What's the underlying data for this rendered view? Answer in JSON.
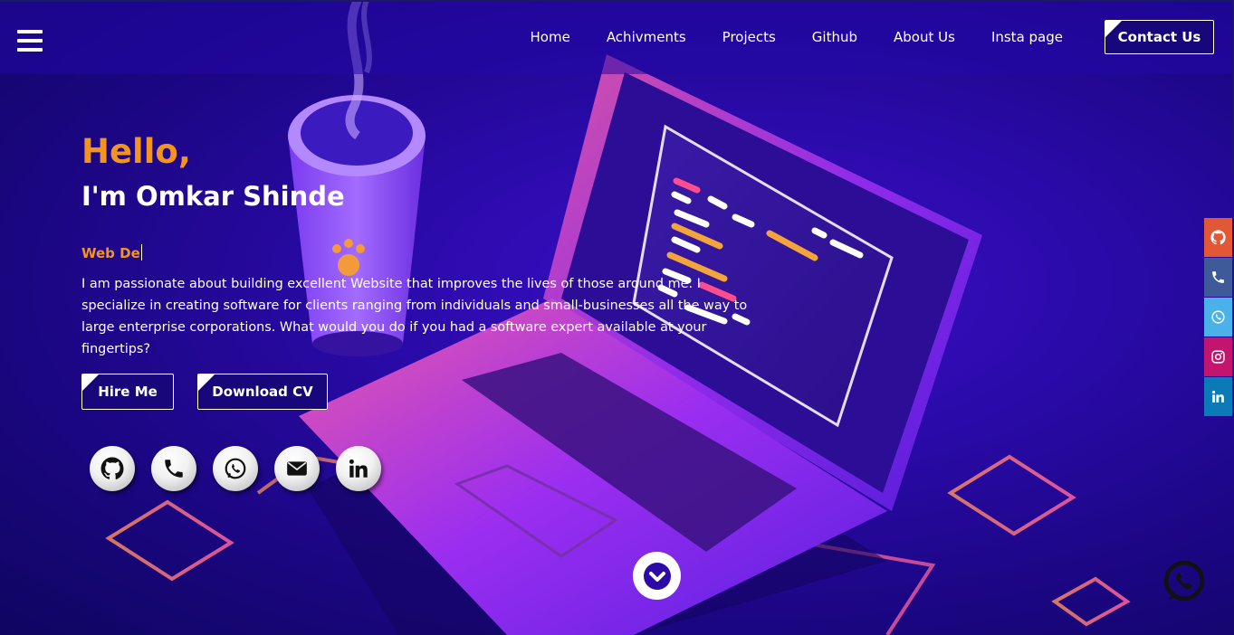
{
  "nav": {
    "items": [
      "Home",
      "Achivments",
      "Projects",
      "Github",
      "About Us",
      "Insta page"
    ],
    "contact_label": "Contact Us"
  },
  "hero": {
    "greeting": "Hello,",
    "name": "I'm Omkar Shinde",
    "role_typed": "Web De",
    "bio": "I am passionate about building excellent Website that improves the lives of those around me. I specialize in creating software for clients ranging from individuals and small-businesses all the way to large enterprise corporations. What would you do if you had a software expert available at your fingertips?",
    "hire_label": "Hire Me",
    "cv_label": "Download CV"
  },
  "social_icons": [
    "github-icon",
    "phone-icon",
    "whatsapp-icon",
    "email-icon",
    "linkedin-icon"
  ],
  "sidebar": [
    {
      "icon": "github-icon",
      "color": "#e25736"
    },
    {
      "icon": "phone-icon",
      "color": "#3f5a99"
    },
    {
      "icon": "whatsapp-icon",
      "color": "#4ab2e8"
    },
    {
      "icon": "instagram-icon",
      "color": "#c4156e"
    },
    {
      "icon": "linkedin-icon",
      "color": "#0b7bb8"
    }
  ],
  "colors": {
    "accent": "#f3941f",
    "background": "#2a0aa8"
  }
}
